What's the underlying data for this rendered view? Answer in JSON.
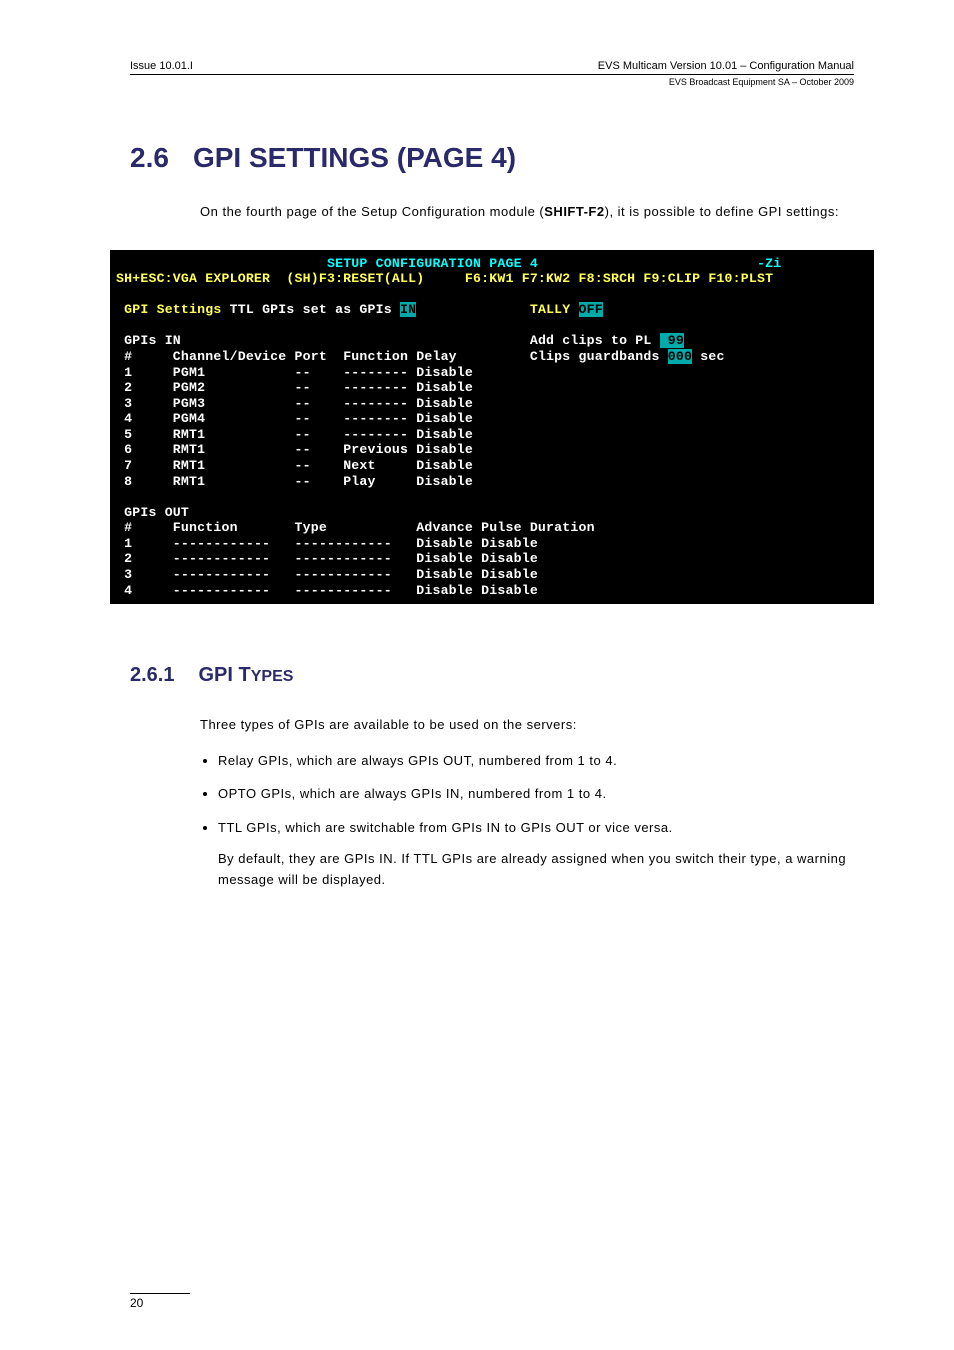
{
  "header": {
    "left": "Issue 10.01.I",
    "right_main": "EVS Multicam Version 10.01 – Configuration Manual",
    "right_sub": "EVS Broadcast Equipment SA – October 2009"
  },
  "section": {
    "num": "2.6",
    "title": "GPI SETTINGS (PAGE 4)",
    "intro_a": "On the fourth page of the Setup Configuration module (",
    "shortcut": "SHIFT-F2",
    "intro_b": "), it is possible to define GPI settings:"
  },
  "terminal": {
    "title": "SETUP CONFIGURATION PAGE 4",
    "zi": "-Zi",
    "menu_left": "SH+ESC:VGA EXPLORER  (SH)F3:RESET(ALL)",
    "menu_right": "F6:KW1 F7:KW2 F8:SRCH F9:CLIP F10:PLST",
    "gpi_settings_label": "GPI Settings",
    "gpi_settings_text": " TTL GPIs set as GPIs ",
    "gpi_settings_val": "IN",
    "tally_label": "TALLY ",
    "tally_val": "OFF",
    "in_title": "GPIs IN",
    "add_clips_label": "Add clips to PL ",
    "add_clips_val": " 99",
    "in_header": "#     Channel/Device Port  Function Delay",
    "guard_label": "Clips guardbands ",
    "guard_val": "000",
    "guard_unit": " sec",
    "in_rows": [
      "1     PGM1           --    -------- Disable",
      "2     PGM2           --    -------- Disable",
      "3     PGM3           --    -------- Disable",
      "4     PGM4           --    -------- Disable",
      "5     RMT1           --    -------- Disable",
      "6     RMT1           --    Previous Disable",
      "7     RMT1           --    Next     Disable",
      "8     RMT1           --    Play     Disable"
    ],
    "out_title": "GPIs OUT",
    "out_header": "#     Function       Type           Advance Pulse Duration",
    "out_rows": [
      "1     ------------   ------------   Disable Disable",
      "2     ------------   ------------   Disable Disable",
      "3     ------------   ------------   Disable Disable",
      "4     ------------   ------------   Disable Disable"
    ]
  },
  "subsection": {
    "num": "2.6.1",
    "title_big": "GPI T",
    "title_small": "YPES",
    "intro": "Three types of GPIs are available to be used on the servers:",
    "bullets": [
      "Relay GPIs, which are always GPIs OUT, numbered from 1 to 4.",
      "OPTO GPIs, which are always GPIs IN, numbered from 1 to 4.",
      "TTL GPIs, which are switchable from GPIs IN to GPIs OUT or vice versa."
    ],
    "after": "By default, they are GPIs IN. If TTL GPIs are already assigned when you switch their type, a warning message will be displayed."
  },
  "footer": {
    "page": "20"
  }
}
